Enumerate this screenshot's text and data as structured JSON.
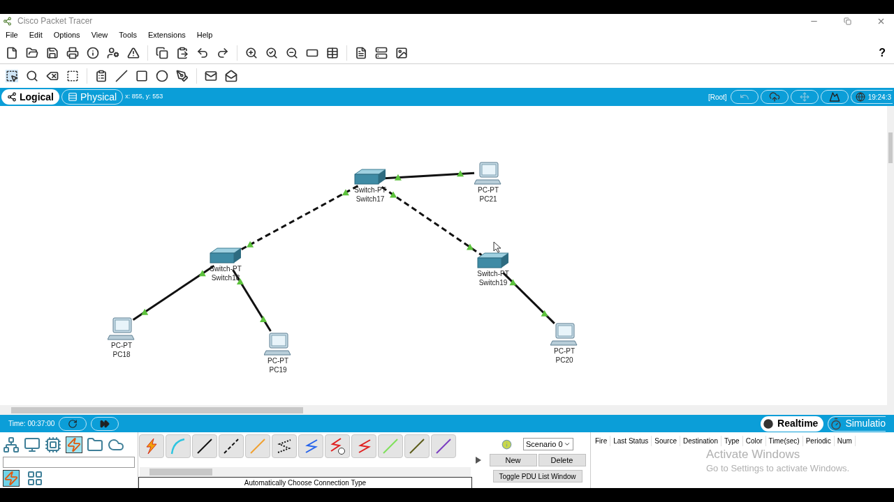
{
  "window": {
    "title": "Cisco Packet Tracer"
  },
  "menu": [
    "File",
    "Edit",
    "Options",
    "View",
    "Tools",
    "Extensions",
    "Help"
  ],
  "help_button": "?",
  "workspace_tabs": [
    {
      "label": "Logical",
      "selected": true
    },
    {
      "label": "Physical",
      "selected": false
    }
  ],
  "cursor_position": "x: 855, y: 553",
  "root_label": "[Root]",
  "clock": "19:24:3",
  "nodes": [
    {
      "kind": "switch",
      "model": "Switch-PT",
      "name": "Switch17"
    },
    {
      "kind": "pc",
      "model": "PC-PT",
      "name": "PC21"
    },
    {
      "kind": "switch",
      "model": "Switch-PT",
      "name": "Switch18"
    },
    {
      "kind": "switch",
      "model": "Switch-PT",
      "name": "Switch19"
    },
    {
      "kind": "pc",
      "model": "PC-PT",
      "name": "PC18"
    },
    {
      "kind": "pc",
      "model": "PC-PT",
      "name": "PC19"
    },
    {
      "kind": "pc",
      "model": "PC-PT",
      "name": "PC20"
    }
  ],
  "links": [
    {
      "kind": "solid"
    },
    {
      "kind": "dashed"
    },
    {
      "kind": "dashed"
    },
    {
      "kind": "solid"
    },
    {
      "kind": "solid"
    },
    {
      "kind": "solid"
    }
  ],
  "time": "Time: 00:37:00",
  "modes": [
    {
      "label": "Realtime",
      "selected": true
    },
    {
      "label": "Simulatio",
      "selected": false
    }
  ],
  "device_categories": [
    {
      "selected": false
    },
    {
      "selected": false
    },
    {
      "selected": false
    },
    {
      "selected": true
    },
    {
      "selected": false
    },
    {
      "selected": false
    }
  ],
  "device_subtypes": [
    {
      "selected": true
    },
    {
      "selected": false
    }
  ],
  "connection_status": "Automatically Choose Connection Type",
  "scenario": {
    "value": "Scenario 0",
    "buttons": [
      "New",
      "Delete"
    ],
    "toggle": "Toggle PDU List Window"
  },
  "pdu_columns": [
    "Fire",
    "Last Status",
    "Source",
    "Destination",
    "Type",
    "Color",
    "Time(sec)",
    "Periodic",
    "Num"
  ],
  "activation_notice": {
    "title": "Activate Windows",
    "text": "Go to Settings to activate Windows."
  }
}
